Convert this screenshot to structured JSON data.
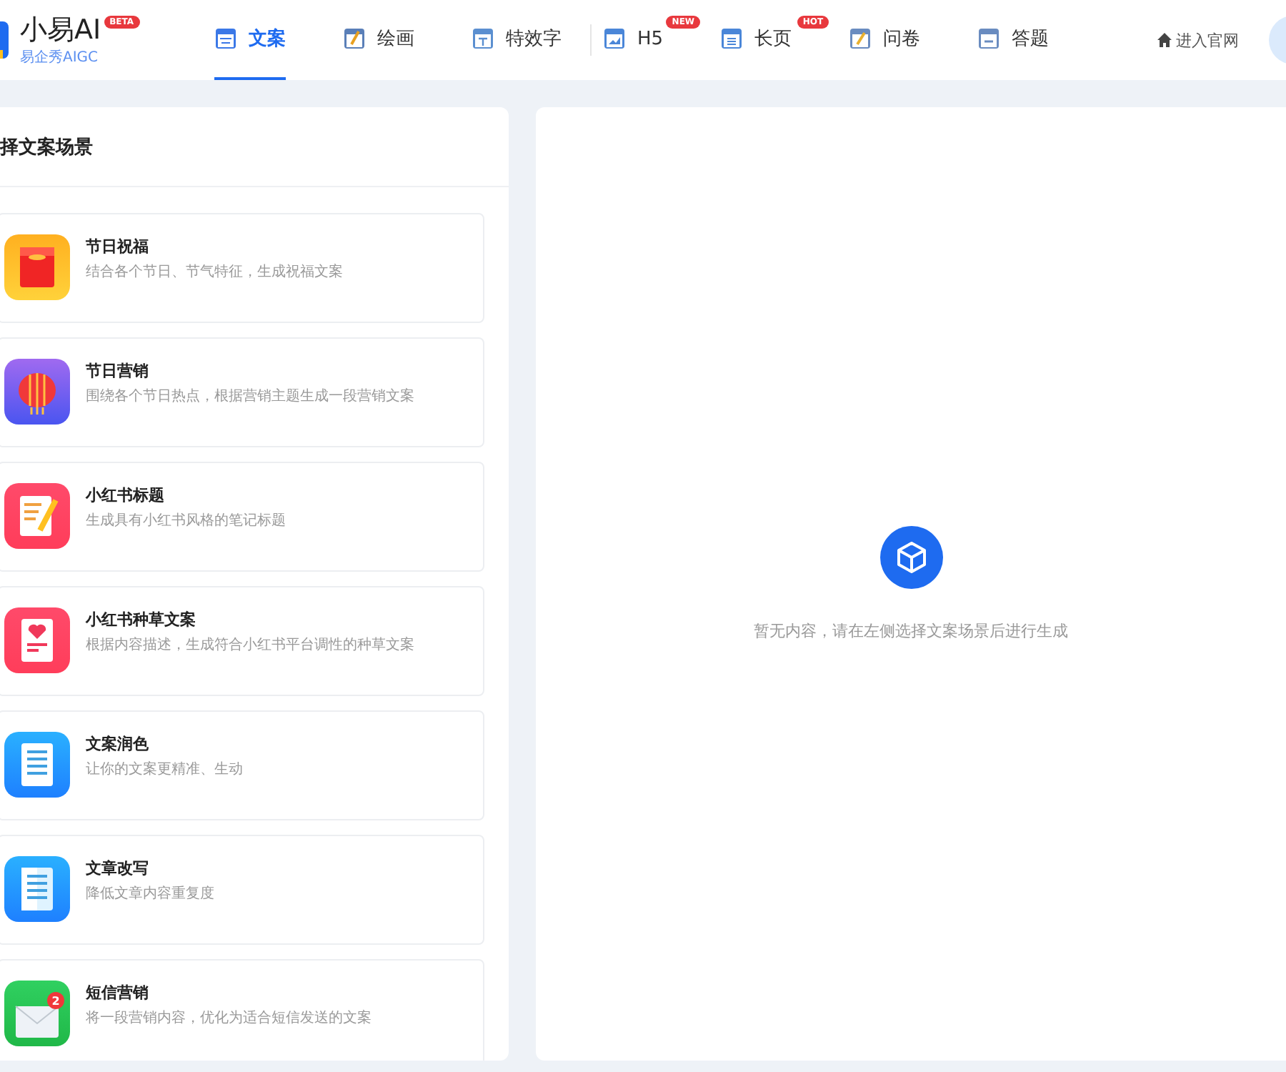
{
  "brand": {
    "name": "小易AI",
    "badge": "BETA",
    "subtitle": "易企秀AIGC"
  },
  "nav": [
    {
      "label": "文案",
      "selected": true,
      "kind": "calendar"
    },
    {
      "label": "绘画",
      "selected": false,
      "kind": "brush"
    },
    {
      "label": "特效字",
      "selected": false,
      "kind": "letter",
      "divider_after": true
    },
    {
      "label": "H5",
      "selected": false,
      "kind": "picture",
      "badge": "NEW"
    },
    {
      "label": "长页",
      "selected": false,
      "kind": "page",
      "badge": "HOT"
    },
    {
      "label": "问卷",
      "selected": false,
      "kind": "pencil"
    },
    {
      "label": "答题",
      "selected": false,
      "kind": "score"
    }
  ],
  "home_link": "进入官网",
  "scenes": {
    "title": "择文案场景",
    "items": [
      {
        "kind": "envelope",
        "title": "节日祝福",
        "desc": "结合各个节日、节气特征，生成祝福文案"
      },
      {
        "kind": "lantern",
        "title": "节日营销",
        "desc": "围绕各个节日热点，根据营销主题生成一段营销文案"
      },
      {
        "kind": "note",
        "title": "小红书标题",
        "desc": "生成具有小红书风格的笔记标题"
      },
      {
        "kind": "heart",
        "title": "小红书种草文案",
        "desc": "根据内容描述，生成符合小红书平台调性的种草文案"
      },
      {
        "kind": "doc",
        "title": "文案润色",
        "desc": "让你的文案更精准、生动"
      },
      {
        "kind": "split",
        "title": "文章改写",
        "desc": "降低文章内容重复度"
      },
      {
        "kind": "mail",
        "title": "短信营销",
        "desc": "将一段营销内容，优化为适合短信发送的文案",
        "count": "2"
      }
    ]
  },
  "empty": {
    "message": "暂无内容，请在左侧选择文案场景后进行生成"
  }
}
